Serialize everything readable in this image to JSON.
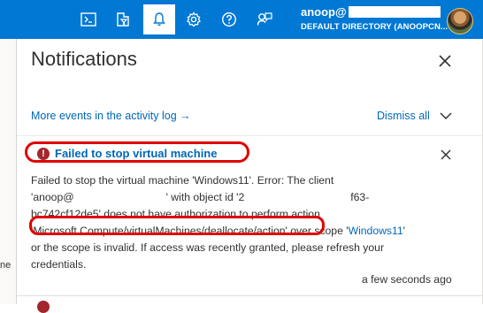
{
  "header": {
    "user_name": "anoop@",
    "directory": "DEFAULT DIRECTORY (ANOOPCN...",
    "icons": [
      "cloud-shell-icon",
      "directory-filter-icon",
      "notifications-icon",
      "settings-icon",
      "help-icon",
      "feedback-icon"
    ]
  },
  "left_blade": {
    "visible_text": "ne"
  },
  "panel": {
    "title": "Notifications",
    "activity_link": "More events in the activity log →",
    "dismiss_all": "Dismiss all"
  },
  "notification": {
    "title": "Failed to stop virtual machine",
    "body_lines": {
      "l1": "Failed to stop the virtual machine 'Windows11'. Error: The client",
      "l2a": "'anoop@",
      "l2b": "' with object id '2",
      "l2c": "f63-",
      "l3": "bc742cf12de5' does not have authorization to perform action",
      "l4a": "'Microsoft.Compute/virtualMachines/deallocate/action'",
      "l4b": " over scope '",
      "l4c": "Windows11",
      "l4d": "'",
      "l5": "or the scope is invalid. If access was recently granted, please refresh your",
      "l6": "credentials."
    },
    "timestamp": "a few seconds ago"
  },
  "colors": {
    "topbar": "#0078d4",
    "link": "#0067b8",
    "error": "#a4262c",
    "highlight": "#e00000"
  }
}
